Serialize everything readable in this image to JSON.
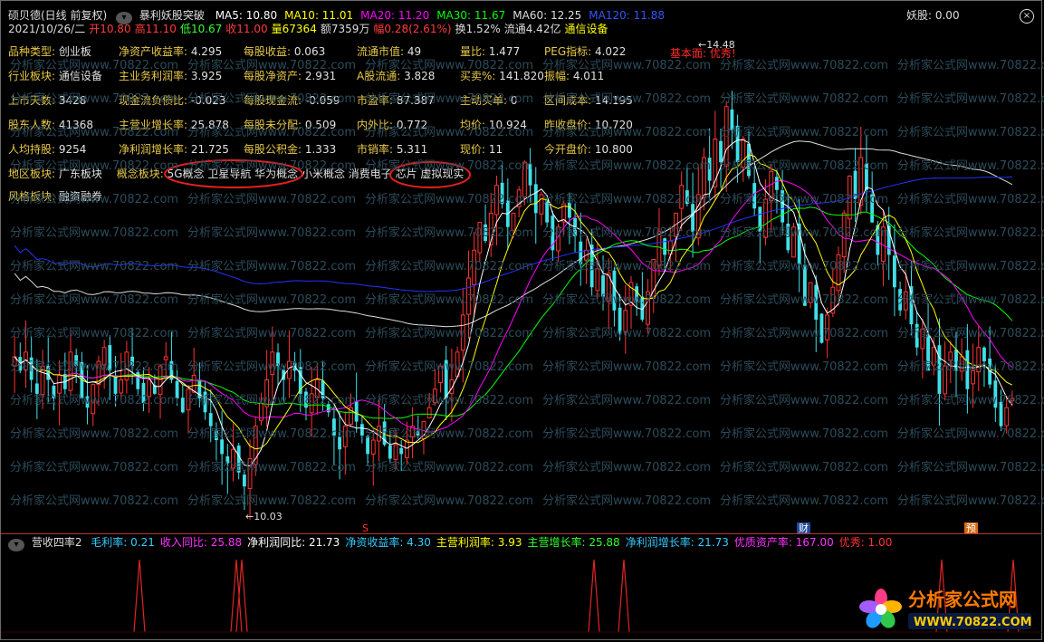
{
  "header": {
    "stock_name": "硕贝德(日线 前复权)",
    "formula": "暴利妖股突破",
    "ma": [
      {
        "label": "MA5: 10.80",
        "color": "#ffffff"
      },
      {
        "label": "MA10: 11.01",
        "color": "#ffff00"
      },
      {
        "label": "MA20: 11.20",
        "color": "#ff00ff"
      },
      {
        "label": "MA30: 11.67",
        "color": "#00ff00"
      },
      {
        "label": "MA60: 12.25",
        "color": "#dddddd"
      },
      {
        "label": "MA120: 11.88",
        "color": "#3355ff"
      }
    ],
    "yao_gu": "妖股: 0.00",
    "quote": [
      {
        "t": "2021/10/26/二",
        "c": "#dddddd"
      },
      {
        "t": "开10.80",
        "c": "#ff3b3b"
      },
      {
        "t": "高11.10",
        "c": "#ff3b3b"
      },
      {
        "t": "低10.67",
        "c": "#33ff33"
      },
      {
        "t": "收11.00",
        "c": "#ff3b3b"
      },
      {
        "t": "量67364",
        "c": "#ffff00"
      },
      {
        "t": "额7359万",
        "c": "#dddddd"
      },
      {
        "t": "幅0.28(2.61%)",
        "c": "#ff3b3b"
      },
      {
        "t": "换1.52%",
        "c": "#dddddd"
      },
      {
        "t": "流通4.42亿",
        "c": "#dddddd"
      },
      {
        "t": "通信设备",
        "c": "#ffff00"
      }
    ]
  },
  "fundamentals": [
    [
      [
        "品种类型:",
        "创业板"
      ],
      [
        "净资产收益率:",
        "4.295"
      ],
      [
        "每股收益:",
        "0.063"
      ],
      [
        "流通市值:",
        "49"
      ],
      [
        "量比:",
        "1.477"
      ],
      [
        "PEG指标:",
        "4.022"
      ]
    ],
    [
      [
        "行业板块:",
        "通信设备"
      ],
      [
        "主业务利润率:",
        "3.925"
      ],
      [
        "每股净资产:",
        "2.931"
      ],
      [
        "A股流通:",
        "3.828"
      ],
      [
        "买卖%:",
        "141.820"
      ],
      [
        "振幅:",
        "4.011"
      ]
    ],
    [
      [
        "上市天数:",
        "3428"
      ],
      [
        "现金流负债比:",
        "-0.023"
      ],
      [
        "每股现金流:",
        "-0.059"
      ],
      [
        "市盈率:",
        "87.387"
      ],
      [
        "主动买单:",
        "0"
      ],
      [
        "区间成本:",
        "14.195"
      ]
    ],
    [
      [
        "股东人数:",
        "41368"
      ],
      [
        "主营业增长率:",
        "25.878"
      ],
      [
        "每股未分配:",
        "0.509"
      ],
      [
        "内外比:",
        "0.772"
      ],
      [
        "均价:",
        "10.924"
      ],
      [
        "昨收盘价:",
        "10.720"
      ]
    ],
    [
      [
        "人均持股:",
        "9254"
      ],
      [
        "净利润增长率:",
        "21.725"
      ],
      [
        "每股公积金:",
        "1.333"
      ],
      [
        "市销率:",
        "5.311"
      ],
      [
        "现价:",
        "11"
      ],
      [
        "今开盘价:",
        "10.800"
      ]
    ]
  ],
  "sectors": {
    "region_label": "地区板块:",
    "region_value": "广东板块",
    "concept_label": "概念板块:",
    "concept_value": "5G概念 卫星导航 华为概念 小米概念 消费电子 芯片 虚拟现实",
    "style_label": "风格板块:",
    "style_value": "融资融券"
  },
  "annotations": {
    "basic": "基本面: 优秀!",
    "high": "14.48",
    "low": "10.03",
    "tag_s": "S",
    "tag_cai": "财",
    "tag_yu": "预"
  },
  "sub": {
    "title": "营收四率2",
    "items": [
      {
        "t": "毛利率: 0.21",
        "c": "#33ccff"
      },
      {
        "t": "收入同比: 25.88",
        "c": "#ff33ff"
      },
      {
        "t": "净利润同比: 21.73",
        "c": "#ffffff"
      },
      {
        "t": "净资收益率: 4.30",
        "c": "#33ccff"
      },
      {
        "t": "主营利润率: 3.93",
        "c": "#ffff00"
      },
      {
        "t": "主营增长率: 25.88",
        "c": "#33ff33"
      },
      {
        "t": "净利润增长率: 21.73",
        "c": "#33ccff"
      },
      {
        "t": "优质资产率: 167.00",
        "c": "#ff33ff"
      },
      {
        "t": "优秀: 1.00",
        "c": "#ff3333"
      }
    ]
  },
  "watermark": "分析家公式网www.70822.com",
  "logo": {
    "name": "分析家公式网",
    "url": "WWW.70822.COM"
  },
  "chart_data": {
    "type": "candlestick",
    "ylim": [
      9.7,
      14.9
    ],
    "close": [
      11.45,
      11.3,
      11.5,
      11.2,
      11.05,
      11.35,
      11.2,
      11.0,
      11.25,
      11.1,
      11.5,
      11.35,
      11.0,
      10.9,
      11.15,
      11.4,
      11.55,
      11.3,
      11.05,
      11.2,
      11.5,
      11.35,
      11.1,
      10.95,
      11.2,
      11.05,
      11.35,
      11.45,
      11.2,
      11.0,
      10.85,
      11.1,
      11.25,
      11.0,
      10.85,
      10.7,
      10.55,
      10.4,
      10.3,
      10.45,
      10.2,
      10.05,
      10.35,
      10.7,
      10.95,
      11.2,
      11.5,
      11.35,
      11.2,
      11.4,
      11.3,
      11.05,
      10.9,
      11.05,
      11.2,
      11.0,
      10.85,
      10.6,
      10.45,
      10.7,
      10.9,
      10.75,
      10.6,
      10.4,
      10.55,
      10.7,
      10.5,
      10.35,
      10.5,
      10.4,
      10.55,
      10.7,
      10.6,
      10.75,
      10.9,
      11.1,
      11.35,
      11.0,
      11.2,
      11.5,
      11.9,
      12.3,
      12.6,
      12.9,
      12.7,
      13.0,
      13.3,
      13.1,
      12.85,
      13.0,
      13.25,
      13.55,
      13.3,
      13.0,
      13.2,
      12.9,
      12.6,
      12.85,
      13.1,
      12.95,
      12.75,
      12.45,
      12.6,
      12.2,
      12.4,
      12.1,
      12.35,
      11.95,
      11.7,
      11.95,
      12.25,
      12.05,
      11.85,
      12.15,
      12.5,
      12.8,
      12.55,
      12.7,
      13.0,
      13.3,
      13.1,
      12.8,
      13.2,
      13.6,
      13.35,
      13.8,
      13.55,
      14.15,
      13.9,
      13.55,
      13.8,
      13.4,
      13.05,
      12.8,
      13.15,
      13.45,
      13.25,
      12.9,
      12.6,
      12.85,
      12.45,
      12.0,
      12.25,
      11.85,
      11.6,
      11.9,
      12.2,
      12.55,
      13.0,
      13.4,
      13.15,
      13.6,
      13.25,
      12.9,
      12.55,
      12.85,
      12.55,
      12.2,
      11.95,
      12.15,
      11.8,
      11.55,
      11.75,
      11.3,
      11.55,
      11.05,
      11.35,
      11.5,
      11.3,
      11.45,
      11.1,
      11.3,
      11.55,
      11.4,
      11.15,
      10.9,
      10.7,
      10.9,
      11.0
    ],
    "ma_colors": {
      "ma5": "#ffffff",
      "ma10": "#ffff00",
      "ma20": "#ff00ff",
      "ma30": "#00ff00",
      "ma60": "#dddddd",
      "ma120": "#2233ff"
    },
    "sub_spikes": [
      153,
      260,
      266,
      655,
      688,
      1039,
      1118
    ]
  }
}
